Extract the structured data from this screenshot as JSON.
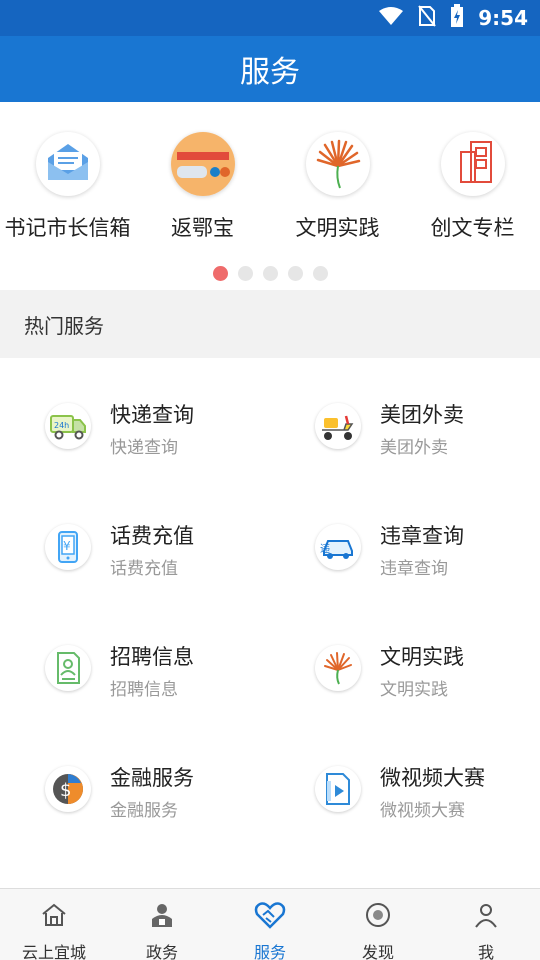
{
  "status_bar": {
    "time": "9:54"
  },
  "header": {
    "title": "服务"
  },
  "quick_links": [
    {
      "label": "书记市长信箱",
      "icon": "mailbox-icon"
    },
    {
      "label": "返鄂宝",
      "icon": "return-hubei-icon"
    },
    {
      "label": "文明实践",
      "icon": "civilization-icon"
    },
    {
      "label": "创文专栏",
      "icon": "building-icon"
    }
  ],
  "carousel": {
    "page_count": 5,
    "active_page": 1
  },
  "hot_services": {
    "heading": "热门服务",
    "items": [
      {
        "title": "快递查询",
        "subtitle": "快递查询",
        "icon": "delivery-truck-icon"
      },
      {
        "title": "美团外卖",
        "subtitle": "美团外卖",
        "icon": "scooter-icon"
      },
      {
        "title": "话费充值",
        "subtitle": "话费充值",
        "icon": "phone-recharge-icon"
      },
      {
        "title": "违章查询",
        "subtitle": "违章查询",
        "icon": "car-violation-icon"
      },
      {
        "title": "招聘信息",
        "subtitle": "招聘信息",
        "icon": "resume-icon"
      },
      {
        "title": "文明实践",
        "subtitle": "文明实践",
        "icon": "civilization-icon"
      },
      {
        "title": "金融服务",
        "subtitle": "金融服务",
        "icon": "finance-globe-icon"
      },
      {
        "title": "微视频大赛",
        "subtitle": "微视频大赛",
        "icon": "video-icon"
      }
    ]
  },
  "bottom_nav": [
    {
      "label": "云上宜城",
      "icon": "home-icon",
      "active": false
    },
    {
      "label": "政务",
      "icon": "government-icon",
      "active": false
    },
    {
      "label": "服务",
      "icon": "handshake-icon",
      "active": true
    },
    {
      "label": "发现",
      "icon": "discover-icon",
      "active": false
    },
    {
      "label": "我",
      "icon": "person-icon",
      "active": false
    }
  ],
  "colors": {
    "primary": "#1976d2",
    "status_bar": "#1565c0",
    "active_dot": "#ef6b6b"
  }
}
